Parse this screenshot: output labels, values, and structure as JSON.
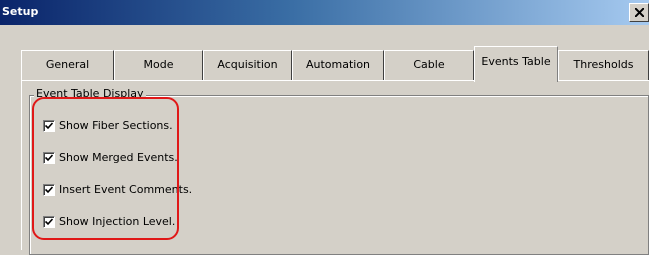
{
  "window": {
    "title": "Setup",
    "close_label": "X"
  },
  "tabs": [
    {
      "label": "General",
      "active": false
    },
    {
      "label": "Mode",
      "active": false
    },
    {
      "label": "Acquisition",
      "active": false
    },
    {
      "label": "Automation",
      "active": false
    },
    {
      "label": "Cable",
      "active": false
    },
    {
      "label": "Events Table",
      "active": true
    },
    {
      "label": "Thresholds",
      "active": false
    }
  ],
  "group": {
    "label": "Event Table Display",
    "options": [
      {
        "label": "Show Fiber Sections.",
        "checked": true
      },
      {
        "label": "Show Merged Events.",
        "checked": true
      },
      {
        "label": "Insert Event Comments.",
        "checked": true
      },
      {
        "label": "Show Injection Level.",
        "checked": true
      }
    ]
  },
  "annotation": {
    "color": "#e01818"
  }
}
